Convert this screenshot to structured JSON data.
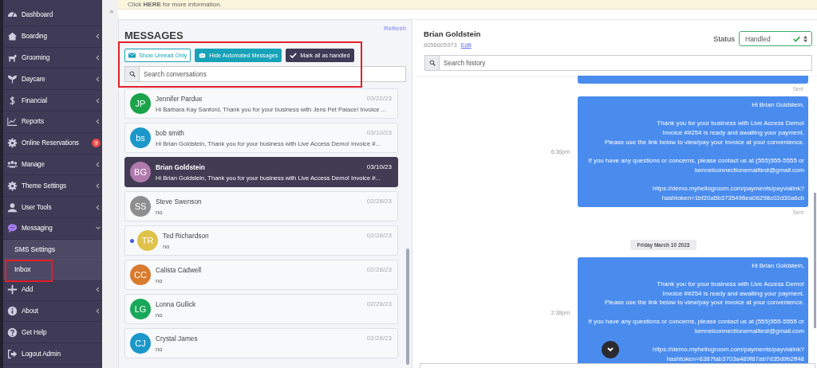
{
  "sidebar": {
    "items": [
      {
        "label": "Dashboard",
        "kind": "link"
      },
      {
        "label": "Boarding",
        "kind": "menu",
        "expanded": false
      },
      {
        "label": "Grooming",
        "kind": "menu",
        "expanded": false
      },
      {
        "label": "Daycare",
        "kind": "menu",
        "expanded": false
      },
      {
        "label": "Financial",
        "kind": "menu",
        "expanded": false
      },
      {
        "label": "Reports",
        "kind": "menu",
        "expanded": false
      },
      {
        "label": "Online Reservations",
        "kind": "link",
        "badge": "9"
      },
      {
        "label": "Manage",
        "kind": "menu",
        "expanded": false
      },
      {
        "label": "Theme Settings",
        "kind": "menu",
        "expanded": false
      },
      {
        "label": "User Tools",
        "kind": "menu",
        "expanded": false
      },
      {
        "label": "Messaging",
        "kind": "menu",
        "expanded": true,
        "children": [
          {
            "label": "SMS Settings"
          },
          {
            "label": "Inbox"
          }
        ]
      },
      {
        "label": "Add",
        "kind": "menu",
        "expanded": false
      },
      {
        "label": "About",
        "kind": "menu",
        "expanded": false
      },
      {
        "label": "Get Help",
        "kind": "link"
      },
      {
        "label": "Logout Admin",
        "kind": "link"
      }
    ]
  },
  "banner": {
    "text": "Click **HERE** for more information."
  },
  "messages": {
    "title": "MESSAGES",
    "refresh": "Refresh",
    "buttons": [
      {
        "label": "Show Unread Only",
        "kind": "outline"
      },
      {
        "label": "Hide Automated Messages",
        "kind": "filled"
      },
      {
        "label": "Mark all as handled",
        "kind": "dark"
      }
    ],
    "search": {
      "placeholder": "Search conversations"
    },
    "conversations": [
      {
        "initials": "JP",
        "name": "Jennifer Pardue",
        "date": "03/22/23",
        "preview": "Hi Barbara Kay Sanford, Thank you for your business with Jens Pet Palace! Invoice ...",
        "color": "#1aa34a",
        "selected": false,
        "unread": false
      },
      {
        "initials": "bs",
        "name": "bob smith",
        "date": "03/10/23",
        "preview": "Hi Brian Goldstein, Thank you for your business with Live Access Demo! Invoice #...",
        "color": "#1b98c9",
        "selected": false,
        "unread": false
      },
      {
        "initials": "BG",
        "name": "Brian Goldstein",
        "date": "03/10/23",
        "preview": "Hi Brian Goldstein, Thank you for your business with Live Access Demo! Invoice #...",
        "color": "#b07aad",
        "selected": true,
        "unread": false
      },
      {
        "initials": "SS",
        "name": "Steve Swenson",
        "date": "02/28/23",
        "preview": "no",
        "color": "#8e8e8e",
        "selected": false,
        "unread": false
      },
      {
        "initials": "TR",
        "name": "Ted Richardson",
        "date": "02/28/23",
        "preview": "no",
        "color": "#e0c24a",
        "selected": false,
        "unread": true
      },
      {
        "initials": "CC",
        "name": "Calista Cadwell",
        "date": "02/28/23",
        "preview": "no",
        "color": "#d97b2e",
        "selected": false,
        "unread": false
      },
      {
        "initials": "LG",
        "name": "Lonna Gullick",
        "date": "02/28/23",
        "preview": "no",
        "color": "#19a85b",
        "selected": false,
        "unread": false
      },
      {
        "initials": "CJ",
        "name": "Crystal James",
        "date": "02/28/23",
        "preview": "no",
        "color": "#1b98c9",
        "selected": false,
        "unread": false
      }
    ]
  },
  "chat": {
    "name": "Brian Goldstein",
    "phone": "8056605973",
    "edit": "Edit",
    "status_label": "Status",
    "status": {
      "value": "Handled",
      "handled": true
    },
    "search": {
      "placeholder": "Search history"
    },
    "entries": [
      {
        "kind": "message",
        "sent": "Sent"
      },
      {
        "kind": "message",
        "time": "6:36pm",
        "sent": "Sent",
        "paragraphs": [
          [
            "Hi Brian Goldstein,"
          ],
          [
            "Thank you for your business with Live Access Demo!",
            "Invoice ##254 is ready and awaiting your payment.",
            "Please use the link below to view/pay your invoice at your convenience."
          ],
          [
            "If you have any questions or concerns, please contact us at (555)555-5555 or",
            "kennelconnectionemailtest@gmail.com"
          ],
          [
            "https://demo.myhellogroom.com/payments/payvialink?",
            "hashtoken=1bf20a5b3735496ea06298c02d30a6cb"
          ]
        ]
      },
      {
        "kind": "date",
        "text": "Friday March 10 2023"
      },
      {
        "kind": "message",
        "time": "2:38pm",
        "paragraphs": [
          [
            "Hi Brian Goldstein,"
          ],
          [
            "Thank you for your business with Live Access Demo!",
            "Invoice ##254 is ready and awaiting your payment.",
            "Please use the link below to view/pay your invoice at your convenience."
          ],
          [
            "If you have any questions or concerns, please contact us at (555)555-5555 or",
            "kennelconnectionemailtest@gmail.com"
          ],
          [
            "https://demo.myhellogroom.com/payments/payvialink?",
            "hashtoken=6387fab3703a489f87ab7d35d9b2ff48"
          ]
        ]
      }
    ]
  }
}
